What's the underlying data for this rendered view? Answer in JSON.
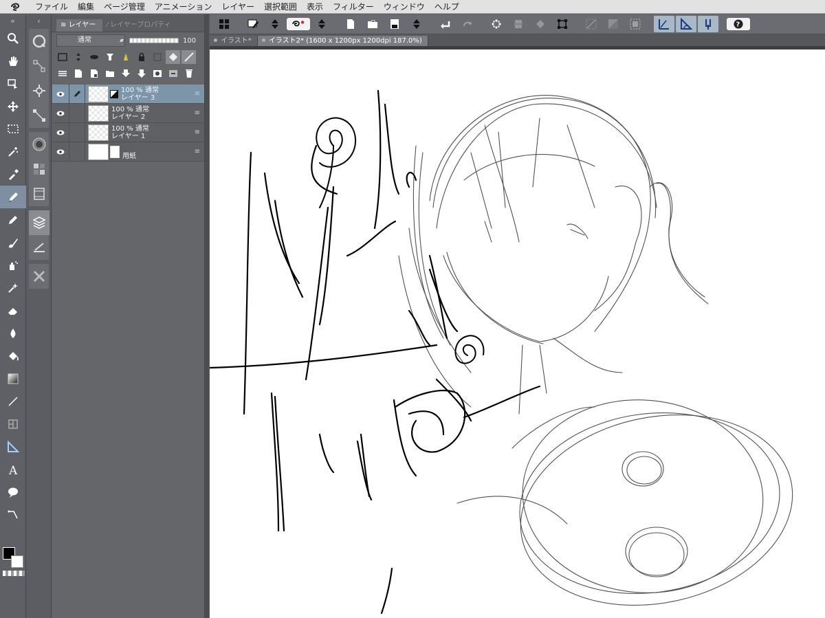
{
  "menubar": {
    "items": [
      "ファイル",
      "編集",
      "ページ管理",
      "アニメーション",
      "レイヤー",
      "選択範囲",
      "表示",
      "フィルター",
      "ウィンドウ",
      "ヘルプ"
    ]
  },
  "command_bar": {
    "icons": [
      "grid-icon",
      "pen-transfer-icon",
      "up-down-icon",
      "clip-logo-icon",
      "up-down-icon",
      "new-file-icon",
      "open-folder-icon",
      "save-icon",
      "up-down-icon",
      "undo-icon",
      "redo-icon",
      "sparkle-icon",
      "clear-icon",
      "fill-icon",
      "transform-icon",
      "deselect-icon",
      "invert-icon",
      "select-all-icon",
      "ruler-snap-icon",
      "special-ruler-icon",
      "grid-snap-icon",
      "help-icon"
    ]
  },
  "canvas_tabs": [
    {
      "label": "イラスト*",
      "active": false
    },
    {
      "label": "イラスト2* (1600 x 1200px 1200dpi 187.0%)",
      "active": true
    }
  ],
  "layer_panel": {
    "tabs": [
      {
        "label": "レイヤー",
        "active": true
      },
      {
        "label": "レイヤープロパティ",
        "active": false
      }
    ],
    "blend_mode": "通常",
    "opacity": "100",
    "layers": [
      {
        "line1": "100 % 通常",
        "line2": "レイヤー 3",
        "selected": true,
        "has_mask": true
      },
      {
        "line1": "100 % 通常",
        "line2": "レイヤー 2",
        "selected": false,
        "has_mask": false
      },
      {
        "line1": "100 % 通常",
        "line2": "レイヤー 1",
        "selected": false,
        "has_mask": false
      },
      {
        "line1": "",
        "line2": "用紙",
        "selected": false,
        "has_mask": false,
        "paper": true
      }
    ]
  },
  "colors": {
    "foreground": "#000000",
    "background": "#ffffff",
    "selection_highlight": "#7d95a8",
    "active_tool": "#7d8fa0"
  },
  "tools": [
    "zoom-icon",
    "hand-icon",
    "operation-icon",
    "move-layer-icon",
    "selection-icon",
    "auto-select-icon",
    "eyedropper-icon",
    "pen-icon",
    "pencil-icon",
    "brush-icon",
    "airbrush-icon",
    "decoration-icon",
    "eraser-icon",
    "blend-icon",
    "fill-icon",
    "gradient-icon",
    "figure-icon",
    "frame-icon",
    "ruler-icon",
    "text-icon",
    "balloon-icon",
    "correct-line-icon"
  ]
}
